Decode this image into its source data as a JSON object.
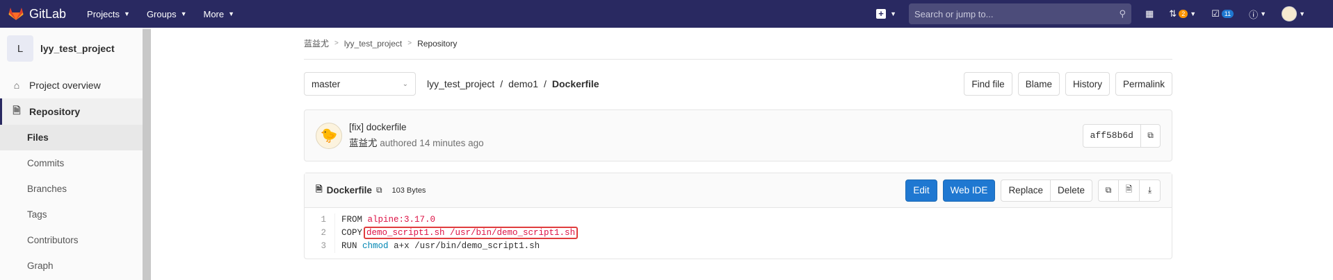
{
  "navbar": {
    "brand": "GitLab",
    "menus": [
      "Projects",
      "Groups",
      "More"
    ],
    "search_placeholder": "Search or jump to...",
    "mr_count": "2",
    "todo_count": "11"
  },
  "sidebar": {
    "project_initial": "L",
    "project_name": "lyy_test_project",
    "overview": "Project overview",
    "repository": "Repository",
    "sub_items": [
      "Files",
      "Commits",
      "Branches",
      "Tags",
      "Contributors",
      "Graph"
    ]
  },
  "breadcrumb": [
    "蓝益尤",
    "lyy_test_project",
    "Repository"
  ],
  "file_nav": {
    "branch": "master",
    "path": [
      "lyy_test_project",
      "demo1"
    ],
    "current_file": "Dockerfile",
    "buttons": [
      "Find file",
      "Blame",
      "History",
      "Permalink"
    ]
  },
  "commit": {
    "title": "[fix] dockerfile",
    "author": "蓝益尤",
    "meta": "authored 14 minutes ago",
    "sha": "aff58b6d"
  },
  "file": {
    "name": "Dockerfile",
    "size": "103 Bytes",
    "edit": "Edit",
    "web_ide": "Web IDE",
    "replace": "Replace",
    "delete": "Delete",
    "line_numbers": [
      "1",
      "2",
      "3"
    ],
    "lines": [
      {
        "kw": "FROM",
        "rest": "alpine:3.17.0"
      },
      {
        "kw": "COPY",
        "rest": "demo_script1.sh /usr/bin/demo_script1.sh"
      },
      {
        "kw": "RUN",
        "fn": "chmod",
        "rest": "a+x /usr/bin/demo_script1.sh"
      }
    ]
  }
}
